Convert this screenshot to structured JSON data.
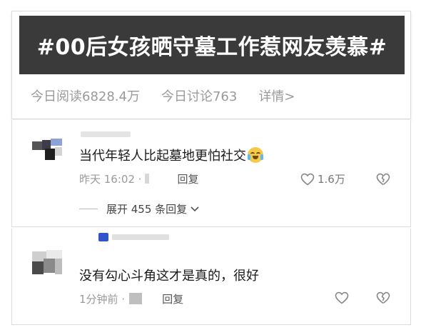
{
  "topic": {
    "title": "#00后女孩晒守墓工作惹网友羡慕#",
    "stats": {
      "reads_today": "今日阅读6828.4万",
      "discussions_today": "今日讨论763",
      "details_link": "详情>"
    }
  },
  "comments": [
    {
      "text": "当代年轻人比起墓地更怕社交",
      "emoji": "crying-laughing-emoji",
      "time": "昨天 16:02 ·",
      "reply_label": "回复",
      "like_count": "1.6万",
      "expand_label": "展开 455 条回复"
    },
    {
      "text": "没有勾心斗角这才是真的，很好",
      "time": "1分钟前 ·",
      "reply_label": "回复",
      "like_count": ""
    }
  ],
  "colors": {
    "banner_bg": "#3a3a3a",
    "muted_text": "#9a9a9a"
  }
}
